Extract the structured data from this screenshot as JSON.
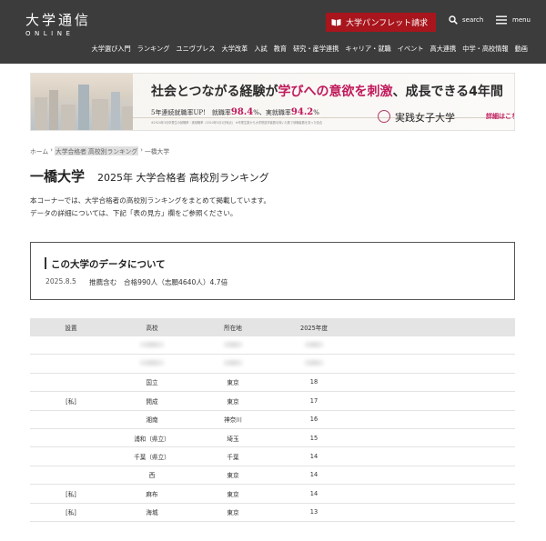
{
  "header": {
    "logo_main": "大学通信",
    "logo_sub": "ONLINE",
    "pamphlet_button": "大学パンフレット請求",
    "search_label": "search",
    "menu_label": "menu",
    "nav": [
      "大学選び入門",
      "ランキング",
      "ユニヴプレス",
      "大学改革",
      "入試",
      "教育",
      "研究・産学連携",
      "キャリア・就職",
      "イベント",
      "高大連携",
      "中学・高校情報",
      "動画"
    ],
    "colors": {
      "bg": "#3c3c3c",
      "accent": "#a8151c"
    }
  },
  "banner": {
    "tagline_pre": "社会とつながる経験が",
    "tagline_hl": "学びへの意欲を刺激",
    "tagline_post": "、成長できる4年間",
    "stats_label1": "5年連続就職率UP!　就職率",
    "stats_value1": "98.4",
    "stats_unit1": "%",
    "stats_label2": "、実就職率",
    "stats_value2": "94.2",
    "stats_unit2": "%",
    "note": "※2024年3月卒業生の就職率・実就職率（2024年5月1日時点） ※卒業生数から大学院進学者数を除いた数で就職者数を割った割合",
    "university": "実践女子大学",
    "detail_link": "詳細はこちら ›"
  },
  "breadcrumb": {
    "home": "ホーム",
    "sep1": "›",
    "mid": "大学合格者 高校別ランキング",
    "sep2": "›",
    "current": "一橋大学"
  },
  "page": {
    "title": "一橋大学",
    "subtitle": "2025年 大学合格者 高校別ランキング",
    "intro1": "本コーナーでは、大学合格者の高校別ランキングをまとめて掲載しています。",
    "intro2": "データの詳細については、下記「表の見方」欄をご参照ください。"
  },
  "info_box": {
    "title": "この大学のデータについて",
    "date": "2025.8.5",
    "detail": "推薦含む　合格990人（志願4640人）4.7倍"
  },
  "table": {
    "headers": [
      "設置",
      "高校",
      "所在地",
      "2025年度"
    ],
    "rows": [
      {
        "type": "",
        "school": "",
        "location": "",
        "count": "",
        "blurred": true
      },
      {
        "type": "",
        "school": "",
        "location": "",
        "count": "",
        "blurred": true
      },
      {
        "type": "",
        "school": "国立",
        "location": "東京",
        "count": "18"
      },
      {
        "type": "[私]",
        "school": "開成",
        "location": "東京",
        "count": "17"
      },
      {
        "type": "",
        "school": "湘南",
        "location": "神奈川",
        "count": "16"
      },
      {
        "type": "",
        "school": "浦和（県立）",
        "location": "埼玉",
        "count": "15"
      },
      {
        "type": "",
        "school": "千葉（県立）",
        "location": "千葉",
        "count": "14"
      },
      {
        "type": "",
        "school": "西",
        "location": "東京",
        "count": "14"
      },
      {
        "type": "[私]",
        "school": "麻布",
        "location": "東京",
        "count": "14"
      },
      {
        "type": "[私]",
        "school": "海城",
        "location": "東京",
        "count": "13"
      }
    ]
  }
}
